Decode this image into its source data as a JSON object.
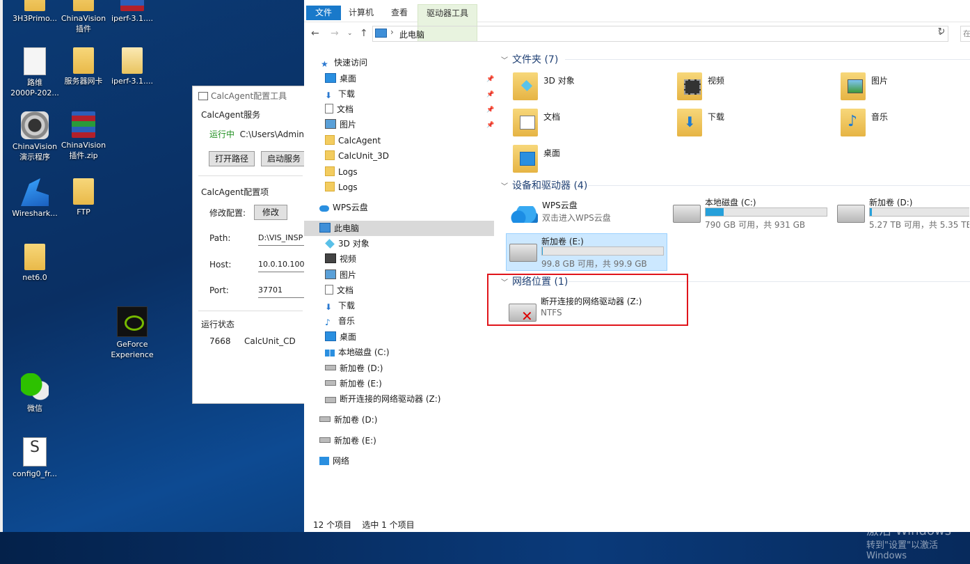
{
  "desktop": {
    "icons": [
      {
        "label": "3H3Primo..."
      },
      {
        "label": "ChinaVision\n插件"
      },
      {
        "label": "iperf-3.1...."
      },
      {
        "label": "路维\n2000P-202..."
      },
      {
        "label": "服务器网卡"
      },
      {
        "label": "iperf-3.1...."
      },
      {
        "label": "ChinaVision\n演示程序"
      },
      {
        "label": "ChinaVision\n插件.zip"
      },
      {
        "label": "Wireshark..."
      },
      {
        "label": "FTP"
      },
      {
        "label": "net6.0"
      },
      {
        "label": "GeForce\nExperience"
      },
      {
        "label": "微信"
      },
      {
        "label": "config0_fr..."
      }
    ]
  },
  "calc_window": {
    "title": "CalcAgent配置工具",
    "service_section": "CalcAgent服务",
    "running_label": "运行中",
    "running_path": "C:\\Users\\Adminis",
    "open_path_button": "打开路径",
    "start_service_button": "启动服务",
    "config_section": "CalcAgent配置项",
    "modify_label": "修改配置:",
    "modify_button": "修改",
    "path_label": "Path:",
    "path_value": "D:\\VIS_INSP",
    "host_label": "Host:",
    "host_value": "10.0.10.100",
    "port_label": "Port:",
    "port_value": "37701",
    "status_section": "运行状态",
    "pid": "7668",
    "process": "CalcUnit_CD"
  },
  "explorer": {
    "ribbon_tabs": [
      {
        "label": "文件"
      },
      {
        "label": "计算机"
      },
      {
        "label": "查看"
      },
      {
        "label": "驱动器工具"
      }
    ],
    "address": {
      "location": "此电脑"
    },
    "search_placeholder": "在",
    "nav": {
      "quick_access": "快速访问",
      "quick_items": [
        {
          "label": "桌面",
          "pinned": true
        },
        {
          "label": "下载",
          "pinned": true
        },
        {
          "label": "文档",
          "pinned": true
        },
        {
          "label": "图片",
          "pinned": true
        },
        {
          "label": "CalcAgent"
        },
        {
          "label": "CalcUnit_3D"
        },
        {
          "label": "Logs"
        },
        {
          "label": "Logs"
        }
      ],
      "wps": "WPS云盘",
      "this_pc": "此电脑",
      "pc_items": [
        {
          "label": "3D 对象"
        },
        {
          "label": "视频"
        },
        {
          "label": "图片"
        },
        {
          "label": "文档"
        },
        {
          "label": "下载"
        },
        {
          "label": "音乐"
        },
        {
          "label": "桌面"
        },
        {
          "label": "本地磁盘 (C:)"
        },
        {
          "label": "新加卷 (D:)"
        },
        {
          "label": "新加卷 (E:)"
        },
        {
          "label": "断开连接的网络驱动器 (Z:)"
        }
      ],
      "drive_d": "新加卷 (D:)",
      "drive_e": "新加卷 (E:)",
      "network": "网络"
    },
    "groups": {
      "folders_header": "文件夹 (7)",
      "folders": [
        {
          "label": "3D 对象"
        },
        {
          "label": "视频"
        },
        {
          "label": "图片"
        },
        {
          "label": "文档"
        },
        {
          "label": "下载"
        },
        {
          "label": "音乐"
        },
        {
          "label": "桌面"
        }
      ],
      "devices_header": "设备和驱动器 (4)",
      "wps": {
        "name": "WPS云盘",
        "sub": "双击进入WPS云盘"
      },
      "drives": [
        {
          "name": "本地磁盘 (C:)",
          "size": "790 GB 可用，共 931 GB",
          "used_fraction": 0.15
        },
        {
          "name": "新加卷 (D:)",
          "size": "5.27 TB 可用，共 5.35 TB",
          "used_fraction": 0.015
        },
        {
          "name": "新加卷 (E:)",
          "size": "99.8 GB 可用，共 99.9 GB",
          "used_fraction": 0.001
        }
      ],
      "network_header": "网络位置 (1)",
      "network_drive": {
        "name": "断开连接的网络驱动器 (Z:)",
        "fs": "NTFS"
      }
    },
    "status": {
      "count": "12 个项目",
      "selected": "选中 1 个项目"
    }
  },
  "watermark": {
    "line1": "激活 Windows",
    "line2": "转到\"设置\"以激活 Windows"
  }
}
